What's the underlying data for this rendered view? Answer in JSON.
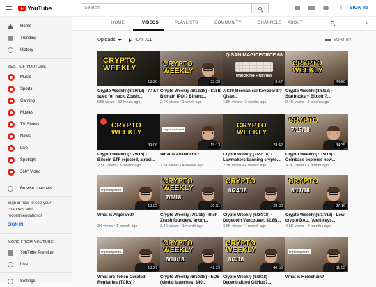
{
  "header": {
    "logo_text": "YouTube",
    "search_placeholder": "Search",
    "sign_in": "SIGN IN"
  },
  "sidebar": {
    "main": [
      {
        "label": "Home",
        "icon": "home-icon"
      },
      {
        "label": "Trending",
        "icon": "trending-icon"
      },
      {
        "label": "History",
        "icon": "history-icon"
      }
    ],
    "best_heading": "BEST OF YOUTUBE",
    "best": [
      {
        "label": "Music"
      },
      {
        "label": "Sports"
      },
      {
        "label": "Gaming"
      },
      {
        "label": "Movies"
      },
      {
        "label": "TV Shows"
      },
      {
        "label": "News"
      },
      {
        "label": "Live"
      },
      {
        "label": "Spotlight"
      },
      {
        "label": "360° Video"
      }
    ],
    "browse_channels": "Browse channels",
    "signin_note": "Sign in now to see your channels and recommendations!",
    "signin_link": "SIGN IN",
    "more_heading": "MORE FROM YOUTUBE",
    "more": [
      {
        "label": "YouTube Premium"
      },
      {
        "label": "Live"
      }
    ],
    "settings": "Settings"
  },
  "tabs": [
    {
      "label": "HOME"
    },
    {
      "label": "VIDEOS"
    },
    {
      "label": "PLAYLISTS"
    },
    {
      "label": "COMMUNITY"
    },
    {
      "label": "CHANNELS"
    },
    {
      "label": "ABOUT"
    }
  ],
  "toolbar": {
    "uploads": "Uploads",
    "play_all": "PLAY ALL",
    "sort_by": "SORT BY"
  },
  "videos": [
    {
      "title": "Crypto Weekly (8/19/18) - AT&T sued for hack, Zcash...",
      "meta": "933 views • 12 hours ago",
      "duration": "19:30",
      "thumb_text": "CRYPTO WEEKLY"
    },
    {
      "title": "Crypto Weekly (8/12/18) - $18B Bitmain IPO!? Binanc...",
      "meta": "2.2K views • 1 week ago",
      "duration": "22:38",
      "thumb_text": "CRYPTO WEEKLY"
    },
    {
      "title": "A $39 Mechanical Keyboard!? Qisan...",
      "meta": "1.9K views • 2 weeks ago",
      "duration": "8:57",
      "thumb_text": "QISAN MAGICFORCE 68",
      "thumb_sub": "UNBOXING + REVIEW"
    },
    {
      "title": "Crypto Weekly (8/5/18) - Starbucks + Bitcoin?...",
      "meta": "2.4K views • 2 weeks ago",
      "duration": "44:50",
      "thumb_text": "CRYPTO WEEKLY"
    },
    {
      "title": "Crypto Weekly (7/29/18) - Bitcoin ETF rejected, atroci...",
      "meta": "2.5K views • 3 weeks ago",
      "duration": "39:06",
      "thumb_text": "CRYPTO WEEKLY"
    },
    {
      "title": "What is Avalanche?",
      "meta": "2.8K views • 4 weeks ago",
      "duration": "15:13",
      "thumb_text": "crypto explained"
    },
    {
      "title": "Crypto Weekly (7/22/18) - Lawmakers banning crypto...",
      "meta": "2.3K views • 4 weeks ago",
      "duration": "28:42",
      "thumb_text": "CRYPTO WEEKLY"
    },
    {
      "title": "Crypto Weekly (7/15/18) - Coinbase explores new...",
      "meta": "3.2K views • 1 month ago",
      "duration": "34:35",
      "thumb_text": "CRYPTO",
      "thumb_date": "7/15/18"
    },
    {
      "title": "What is Algorand?",
      "meta": "3K views • 1 month ago",
      "duration": "13:03",
      "thumb_text": "crypto explained"
    },
    {
      "title": "Crypto Weekly (7/1/18) - Rich Zcash founders, anoth...",
      "meta": "3.4K views • 1 month ago",
      "duration": "36:51",
      "thumb_text": "CRYPTO WEEKLY",
      "thumb_date": "7/1/18"
    },
    {
      "title": "Crypto Weekly (6/24/18) - Dogecoin Vancouver, $2.8B...",
      "meta": "3.6K views • 1 month ago",
      "duration": "28:30",
      "thumb_text": "CRYPTO",
      "thumb_date": "6/24/18"
    },
    {
      "title": "Crypto Weekly (6/17/18) - Low crypto DAU, 'Alert keys...",
      "meta": "4.9K views • 2 months ago",
      "duration": "37:16",
      "thumb_text": "CRYPTO",
      "thumb_date": "6/17/18"
    },
    {
      "title": "What are Token Curated Registries (TCRs)?",
      "meta": "",
      "duration": "13:27",
      "thumb_text": "crypto explained"
    },
    {
      "title": "Crypto Weekly (6/10/18) - EOS (kinda) launches, $40...",
      "meta": "",
      "duration": "41:29",
      "thumb_text": "CRYPTO WEEKLY",
      "thumb_date": "6/10/18"
    },
    {
      "title": "Crypto Weekly (6/3/18) - Decentralized GitHub?...",
      "meta": "",
      "duration": "46:50",
      "thumb_text": "CRYPTO WEEKLY",
      "thumb_date": "6/3/18"
    },
    {
      "title": "What is Holochain?",
      "meta": "",
      "duration": "11:53",
      "thumb_text": "crypto explained"
    }
  ]
}
